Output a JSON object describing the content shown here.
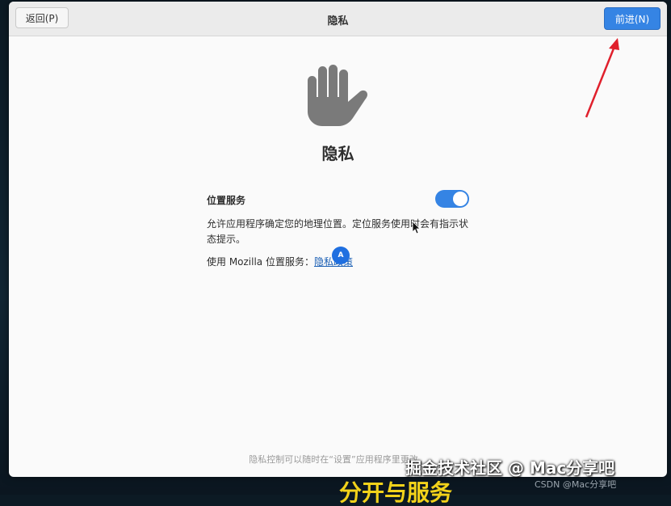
{
  "window": {
    "back_label": "返回(P)",
    "title": "隐私",
    "next_label": "前进(N)"
  },
  "main": {
    "heading": "隐私",
    "hand_icon": "hand-icon",
    "location": {
      "title": "位置服务",
      "enabled": true,
      "description": "允许应用程序确定您的地理位置。定位服务使用时会有指示状态提示。",
      "mozilla_prefix": "使用 Mozilla 位置服务：",
      "mozilla_link": "隐私政策"
    },
    "badge_letter": "A",
    "footer": "隐私控制可以随时在“设置”应用程序里更改。"
  },
  "overlay": {
    "watermark": "掘金技术社区 @ Mac分享吧",
    "csdn": "CSDN @Mac分享吧",
    "subtitle": "分开与服务",
    "arrow_color": "#e0202c"
  },
  "colors": {
    "accent": "#3584e4",
    "link": "#1a5fb4"
  }
}
